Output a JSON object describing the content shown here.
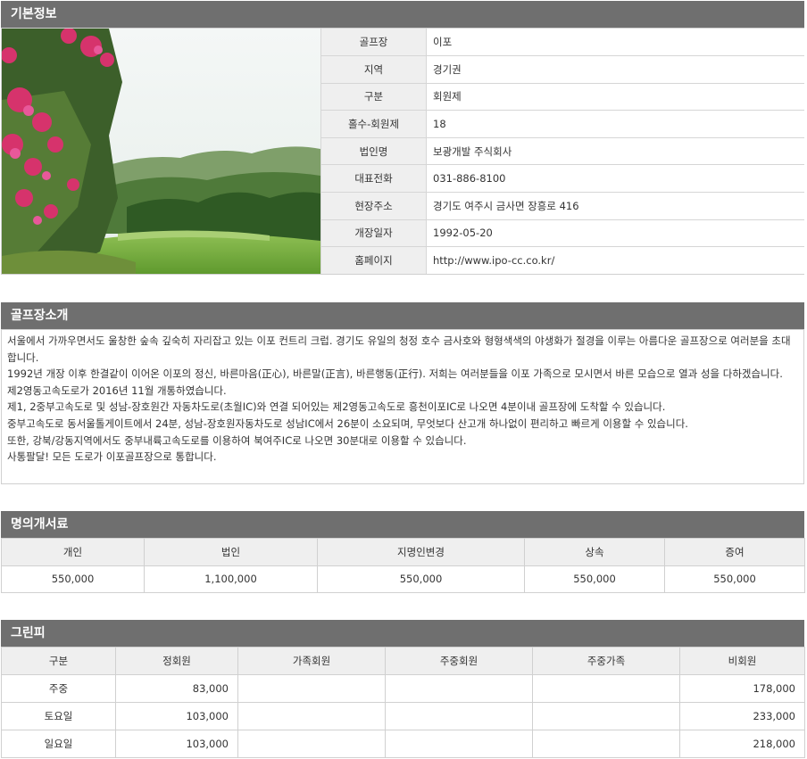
{
  "basic": {
    "heading": "기본정보",
    "rows": [
      {
        "label": "골프장",
        "value": "이포"
      },
      {
        "label": "지역",
        "value": "경기권"
      },
      {
        "label": "구분",
        "value": "회원제"
      },
      {
        "label": "홀수-회원제",
        "value": "18"
      },
      {
        "label": "법인명",
        "value": "보광개발 주식회사"
      },
      {
        "label": "대표전화",
        "value": "031-886-8100"
      },
      {
        "label": "현장주소",
        "value": "경기도 여주시 금사면 장흥로 416"
      },
      {
        "label": "개장일자",
        "value": "1992-05-20"
      },
      {
        "label": "홈페이지",
        "value": "http://www.ipo-cc.co.kr/"
      }
    ]
  },
  "intro": {
    "heading": "골프장소개",
    "lines": [
      "서울에서 가까우면서도 울창한 숲속 깊숙히 자리잡고 있는 이포 컨트리 크럽. 경기도 유일의 청정 호수 금사호와 형형색색의 야생화가 절경을 이루는 아름다운 골프장으로 여러분을 초대합니다.",
      "1992년 개장 이후 한결같이 이어온 이포의 정신, 바른마음(正心), 바른말(正言), 바른행동(正行). 저희는 여러분들을 이포 가족으로 모시면서 바른 모습으로 열과 성을 다하겠습니다.",
      "제2영동고속도로가 2016년 11월 개통하였습니다.",
      "제1, 2중부고속도로 및 성남-장호원간 자동차도로(초월IC)와 연결 되어있는 제2영동고속도로 흥천이포IC로 나오면 4분이내 골프장에 도착할 수 있습니다.",
      "중부고속도로 동서울톨게이트에서 24분, 성남-장호원자동차도로 성남IC에서 26분이 소요되며, 무엇보다 산고개 하나없이 편리하고 빠르게 이용할 수 있습니다.",
      "또한, 강북/강동지역에서도 중부내륙고속도로를 이용하여 북여주IC로 나오면 30분대로 이용할 수 있습니다.",
      "사통팔달! 모든 도로가 이포골프장으로 통합니다."
    ]
  },
  "transfer": {
    "heading": "명의개서료",
    "columns": [
      "개인",
      "법인",
      "지명인변경",
      "상속",
      "증여"
    ],
    "values": [
      "550,000",
      "1,100,000",
      "550,000",
      "550,000",
      "550,000"
    ]
  },
  "greenfee": {
    "heading": "그린피",
    "columns": [
      "구분",
      "정회원",
      "가족회원",
      "주중회원",
      "주중가족",
      "비회원"
    ],
    "rows": [
      {
        "day": "주중",
        "regular": "83,000",
        "family": "",
        "weekday": "",
        "weekday_family": "",
        "nonmember": "178,000"
      },
      {
        "day": "토요일",
        "regular": "103,000",
        "family": "",
        "weekday": "",
        "weekday_family": "",
        "nonmember": "233,000"
      },
      {
        "day": "일요일",
        "regular": "103,000",
        "family": "",
        "weekday": "",
        "weekday_family": "",
        "nonmember": "218,000"
      }
    ]
  }
}
